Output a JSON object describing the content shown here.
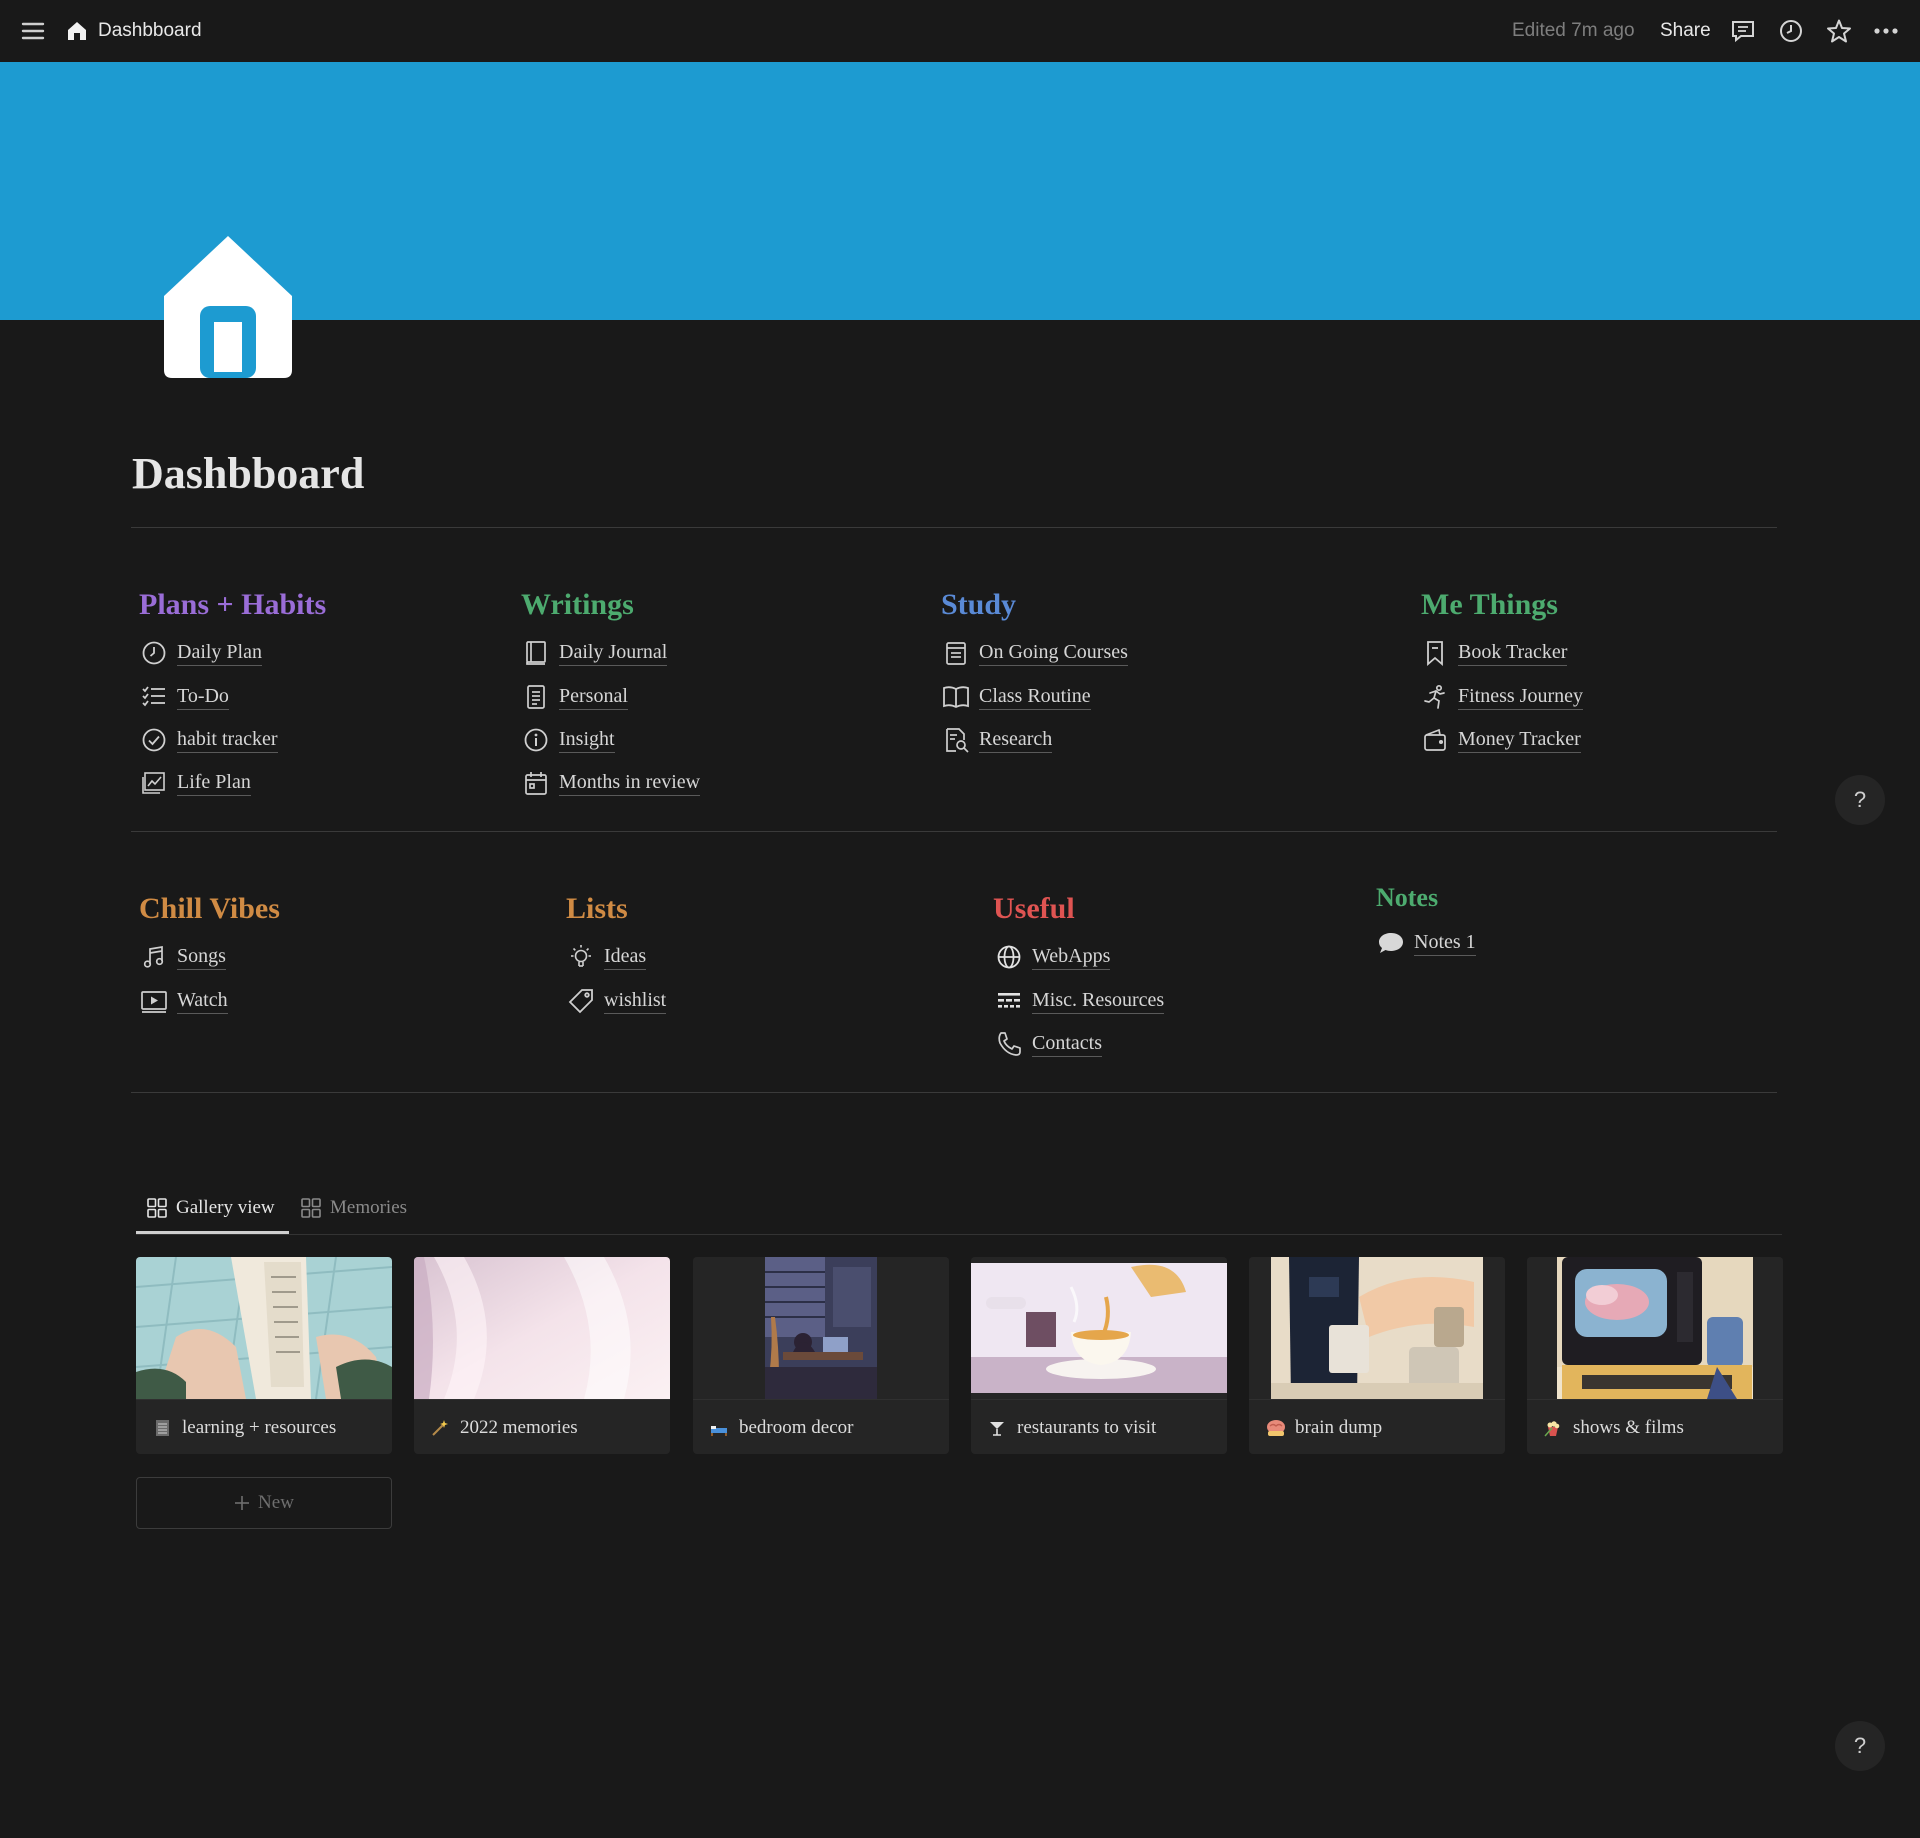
{
  "topbar": {
    "title": "Dashbboard",
    "edited": "Edited 7m ago",
    "share": "Share",
    "icons": [
      "menu-icon",
      "home-icon",
      "comment-icon",
      "clock-icon",
      "star-icon",
      "more-icon"
    ]
  },
  "colors": {
    "cover": "#1d9bd1",
    "background": "#191919",
    "purple": "#9a6dd7",
    "green": "#4dab6f",
    "blue": "#5a8ad6",
    "orange": "#d08b44",
    "red": "#df5452"
  },
  "page": {
    "title": "Dashbboard"
  },
  "sections": {
    "plans": {
      "title": "Plans + Habits",
      "items": [
        "Daily Plan",
        "To-Do",
        "habit tracker",
        "Life Plan"
      ]
    },
    "writings": {
      "title": "Writings",
      "items": [
        "Daily Journal",
        "Personal",
        "Insight",
        "Months in review"
      ]
    },
    "study": {
      "title": "Study",
      "items": [
        "On Going Courses",
        "Class Routine",
        "Research"
      ]
    },
    "me": {
      "title": "Me Things",
      "items": [
        "Book Tracker",
        "Fitness Journey",
        "Money Tracker"
      ]
    },
    "chill": {
      "title": "Chill Vibes",
      "items": [
        "Songs",
        "Watch"
      ]
    },
    "lists": {
      "title": "Lists",
      "items": [
        "Ideas",
        "wishlist"
      ]
    },
    "useful": {
      "title": "Useful",
      "items": [
        "WebApps",
        "Misc. Resources",
        "Contacts"
      ]
    },
    "notes": {
      "title": "Notes",
      "items": [
        "Notes 1"
      ]
    }
  },
  "gallery": {
    "tabs": [
      "Gallery view",
      "Memories"
    ],
    "cards": [
      "learning + resources",
      "2022 memories",
      "bedroom decor",
      "restaurants to visit",
      "brain dump",
      "shows & films"
    ],
    "new_label": "New"
  },
  "help_label": "?"
}
